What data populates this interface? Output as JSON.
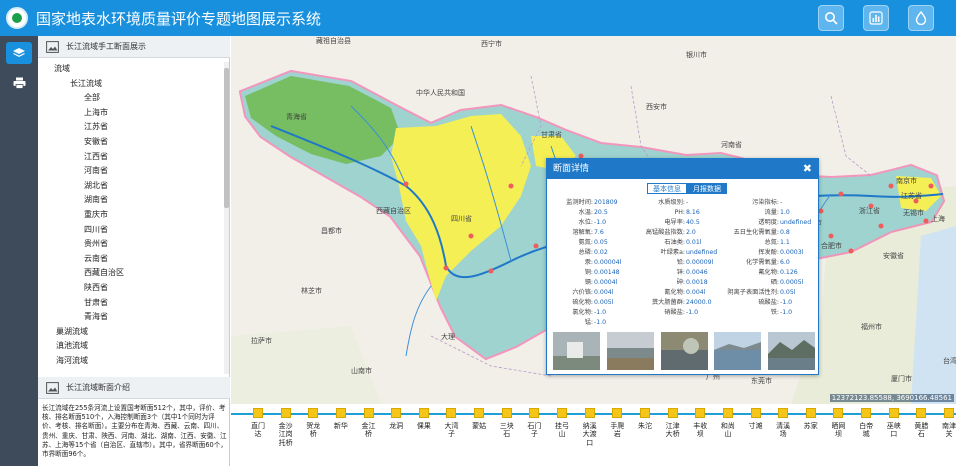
{
  "header": {
    "title": "国家地表水环境质量评价专题地图展示系统"
  },
  "panel": {
    "tree_title": "长江流域手工断面展示",
    "tree": [
      "流域",
      "长江流域",
      "全部",
      "上海市",
      "江苏省",
      "安徽省",
      "江西省",
      "河南省",
      "湖北省",
      "湖南省",
      "重庆市",
      "四川省",
      "贵州省",
      "云南省",
      "西藏自治区",
      "陕西省",
      "甘肃省",
      "青海省",
      "巢湖流域",
      "滇池流域",
      "海河流域"
    ],
    "intro_title": "长江流域断面介绍",
    "intro_text": "长江流域在255条河流上设置国考断面512个，其中，评价、考核、排名断面510个，入海控制断面3个（其中1个同时为评价、考核、排名断面）。主要分布在青海、西藏、云南、四川、贵州、重庆、甘肃、陕西、河南、湖北、湖南、江西、安徽、江苏、上海等15个省（自治区、直辖市）。其中，省界断面60个，市界断面96个。"
  },
  "map": {
    "labels": [
      "藏祖自治县",
      "西宁市",
      "银川市",
      "中华人民共和国",
      "青海省",
      "甘肃省",
      "西安市",
      "河南省",
      "四川省",
      "西藏自治区",
      "贵州省",
      "福州市",
      "南京市",
      "杭州市",
      "安徽省",
      "浙江省",
      "江苏省",
      "江西省",
      "湖南省",
      "湖北省",
      "重庆市",
      "昌都市",
      "林芝市",
      "拉萨市",
      "山南市",
      "大理",
      "合肥市",
      "上海",
      "无锡市",
      "东莞市",
      "厦门市",
      "台湾",
      "广州"
    ],
    "coords": "12372123.85588, 3690166.48561"
  },
  "popup": {
    "title": "断面详情",
    "tabs": [
      "基本信息",
      "月报数据"
    ],
    "fields": [
      [
        "监测时间",
        "201809",
        "水质级别",
        "-",
        "污染指标",
        "-"
      ],
      [
        "水温",
        "20.5",
        "PH",
        "8.16",
        "流量",
        "1.0"
      ],
      [
        "水位",
        "-1.0",
        "电导率",
        "40.5",
        "透明度",
        "undefined"
      ],
      [
        "溶解氧",
        "7.6",
        "高锰酸盐指数",
        "2.0",
        "五日生化需氧量",
        "0.8"
      ],
      [
        "氨氮",
        "0.05",
        "石油类",
        "0.01l",
        "总氮",
        "1.1"
      ],
      [
        "总磷",
        "0.02",
        "叶绿素a",
        "undefined",
        "挥发酚",
        "0.0003l"
      ],
      [
        "汞",
        "0.00004l",
        "铅",
        "0.00009l",
        "化学需氧量",
        "6.0"
      ],
      [
        "铜",
        "0.00148",
        "锌",
        "0.0046",
        "氟化物",
        "0.126"
      ],
      [
        "镉",
        "0.0004l",
        "砷",
        "0.0018",
        "硒",
        "0.0005l"
      ],
      [
        "六价铬",
        "0.004l",
        "氰化物",
        "0.004l",
        "阴离子表面活性剂",
        "0.05l"
      ],
      [
        "硫化物",
        "0.005l",
        "粪大肠菌群",
        "24000.0",
        "硫酸盐",
        "-1.0"
      ],
      [
        "氯化物",
        "-1.0",
        "硝酸盐",
        "-1.0",
        "铁",
        "-1.0"
      ],
      [
        "锰",
        "-1.0",
        "",
        "",
        "",
        ""
      ]
    ]
  },
  "stations": [
    "直门达",
    "金沙江岗托桥",
    "贺龙桥",
    "新华",
    "金江桥",
    "龙洞",
    "倮果",
    "大湾子",
    "蒙姑",
    "三块石",
    "石门子",
    "挂弓山",
    "纳溪大渡口",
    "手爬岩",
    "朱沱",
    "江津大桥",
    "丰收坝",
    "和尚山",
    "寸滩",
    "清溪场",
    "苏家",
    "晒网坝",
    "白帝城",
    "巫峡口",
    "黄腊石",
    "南津关"
  ],
  "colors": {
    "accent": "#1890de",
    "basin": "#9ed3cf",
    "yellow_region": "#f4ef55",
    "station": "#f5c518",
    "river": "#1f78c8"
  }
}
